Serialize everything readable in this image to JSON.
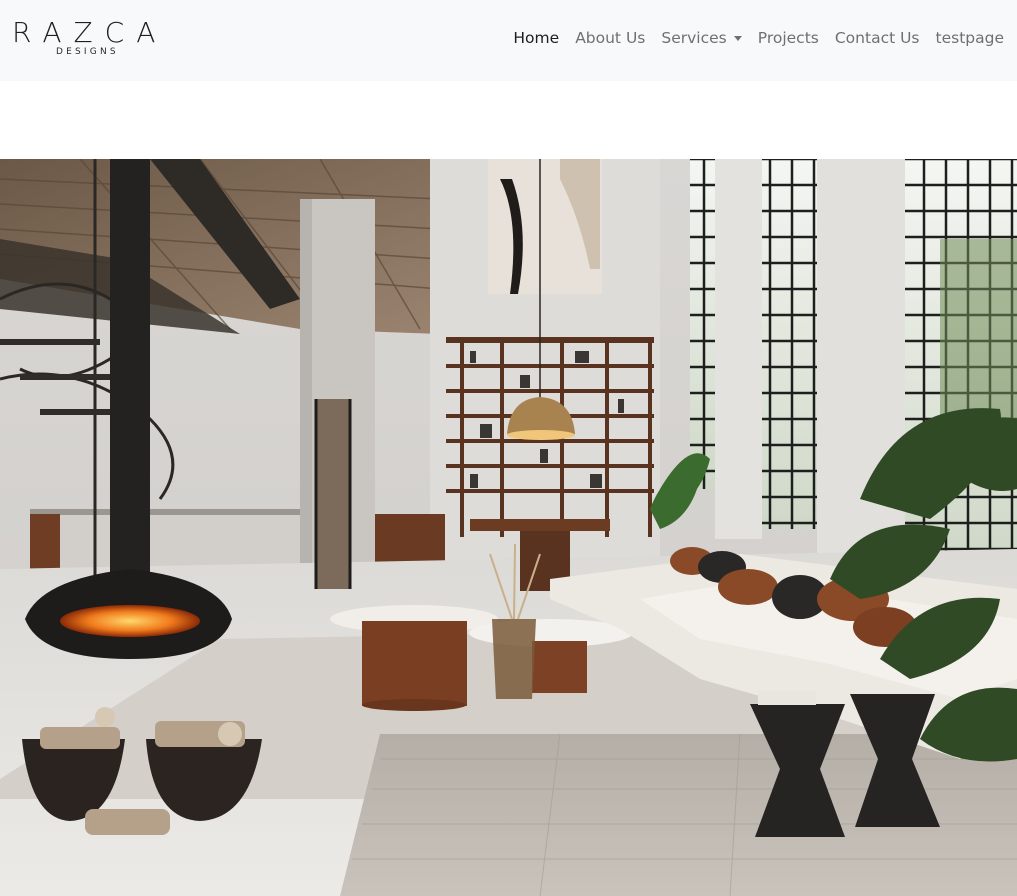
{
  "brand": {
    "name": "RAZCA",
    "tagline": "DESIGNS"
  },
  "nav": {
    "items": [
      {
        "label": "Home",
        "active": true
      },
      {
        "label": "About Us"
      },
      {
        "label": "Services",
        "dropdown": true
      },
      {
        "label": "Projects"
      },
      {
        "label": "Contact Us"
      },
      {
        "label": "testpage"
      }
    ]
  },
  "hero": {
    "image": "loft-living-room-photo"
  },
  "colors": {
    "navbar_bg": "#f8f9fa",
    "nav_active": "#1e1e1e",
    "nav_link": "#707070"
  }
}
